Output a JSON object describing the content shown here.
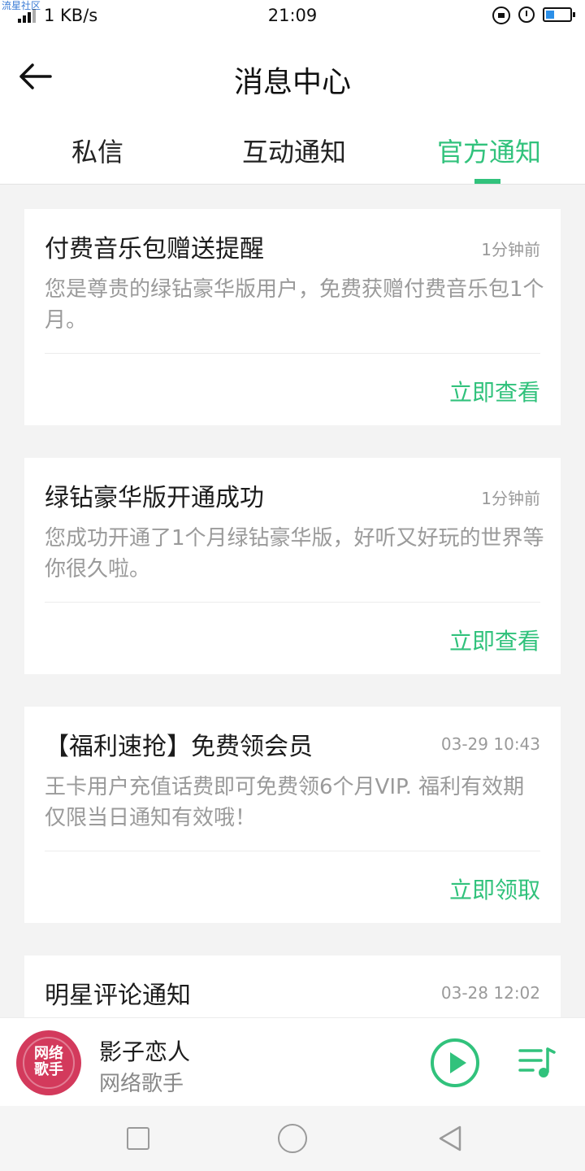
{
  "status_bar": {
    "watermark": "流星社区",
    "net_speed": "1 KB/s",
    "time": "21:09",
    "battery_level": 0.35
  },
  "header": {
    "title": "消息中心"
  },
  "tabs": [
    {
      "label": "私信",
      "active": false
    },
    {
      "label": "互动通知",
      "active": false
    },
    {
      "label": "官方通知",
      "active": true
    }
  ],
  "notifications": [
    {
      "title": "付费音乐包赠送提醒",
      "time": "1分钟前",
      "body": "您是尊贵的绿钻豪华版用户，免费获赠付费音乐包1个月。",
      "action": "立即查看"
    },
    {
      "title": "绿钻豪华版开通成功",
      "time": "1分钟前",
      "body": "您成功开通了1个月绿钻豪华版，好听又好玩的世界等你很久啦。",
      "action": "立即查看"
    },
    {
      "title": "【福利速抢】免费领会员",
      "time": "03-29 10:43",
      "body": "王卡用户充值话费即可免费领6个月VIP. 福利有效期仅限当日通知有效哦！",
      "action": "立即领取"
    },
    {
      "title": "明星评论通知",
      "time": "03-28 12:02"
    }
  ],
  "player": {
    "album_art_text": "网络\n歌手",
    "song_title": "影子恋人",
    "artist": "网络歌手"
  },
  "colors": {
    "accent": "#31c27c",
    "album": "#d33a5c"
  },
  "icons": {
    "back": "arrow-left-icon",
    "play": "play-circle-icon",
    "playlist": "playlist-icon"
  }
}
